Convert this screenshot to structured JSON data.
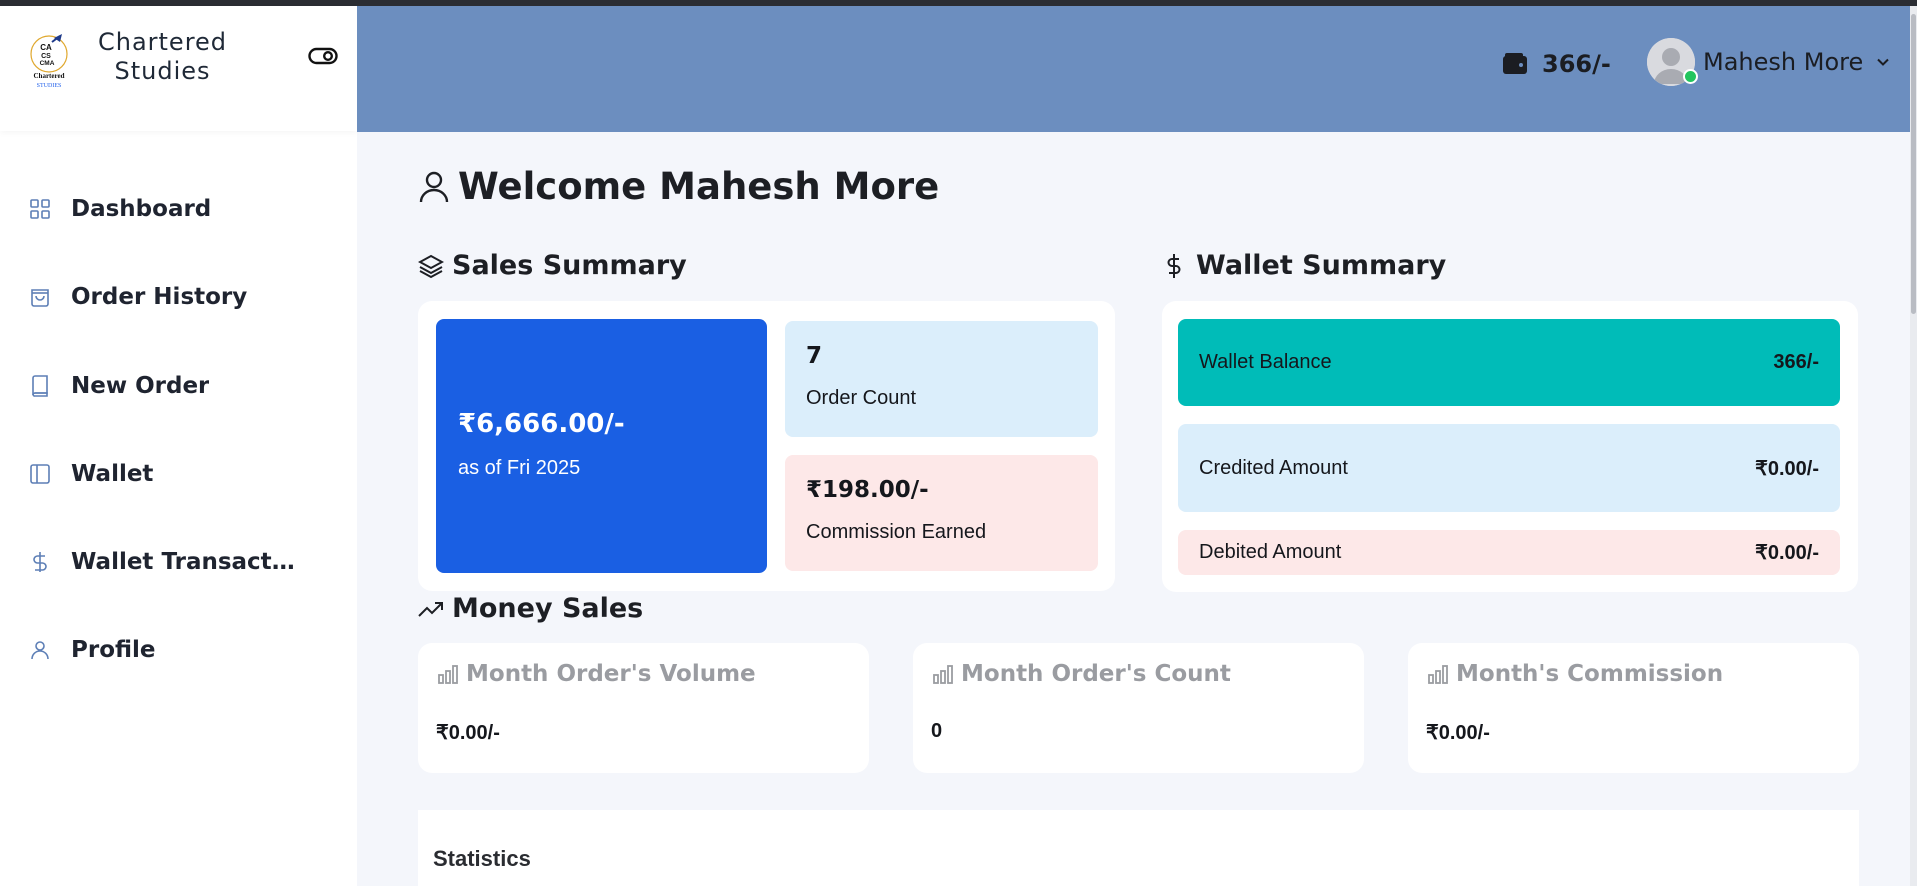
{
  "brand": {
    "name_line1": "Chartered",
    "name_line2": "Studies",
    "logo_text": [
      "CA",
      "CS",
      "CMA",
      "Chartered",
      "STUDIES"
    ]
  },
  "sidebar": {
    "items": [
      {
        "label": "Dashboard",
        "icon": "grid-icon"
      },
      {
        "label": "Order History",
        "icon": "shopping-bag-icon"
      },
      {
        "label": "New Order",
        "icon": "book-icon"
      },
      {
        "label": "Wallet",
        "icon": "sidebar-panel-icon"
      },
      {
        "label": "Wallet Transactions",
        "icon": "dollar-icon"
      },
      {
        "label": "Profile",
        "icon": "user-icon"
      }
    ]
  },
  "header": {
    "wallet_amount": "366/-",
    "user_name": "Mahesh More",
    "status_color": "#22c55e"
  },
  "welcome": {
    "title": "Welcome Mahesh More"
  },
  "sales_summary": {
    "title": "Sales Summary",
    "total_value": "₹6,666.00/-",
    "total_subtitle": "as of Fri 2025",
    "order_count_value": "7",
    "order_count_label": "Order Count",
    "commission_value": "₹198.00/-",
    "commission_label": "Commission Earned"
  },
  "wallet_summary": {
    "title": "Wallet Summary",
    "balance_label": "Wallet Balance",
    "balance_value": "366/-",
    "credited_label": "Credited Amount",
    "credited_value": "₹0.00/-",
    "debited_label": "Debited Amount",
    "debited_value": "₹0.00/-"
  },
  "money_sales": {
    "title": "Money Sales",
    "cards": [
      {
        "label": "Month Order's Volume",
        "value": "₹0.00/-"
      },
      {
        "label": "Month Order's Count",
        "value": "0"
      },
      {
        "label": "Month's Commission",
        "value": "₹0.00/-"
      }
    ]
  },
  "statistics": {
    "title": "Statistics"
  },
  "colors": {
    "header_bg": "#6c8ebf",
    "primary_card": "#1a5fe3",
    "wallet_balance": "#00bcb8",
    "light_blue": "#dbeefb",
    "light_pink": "#fde8e8"
  }
}
